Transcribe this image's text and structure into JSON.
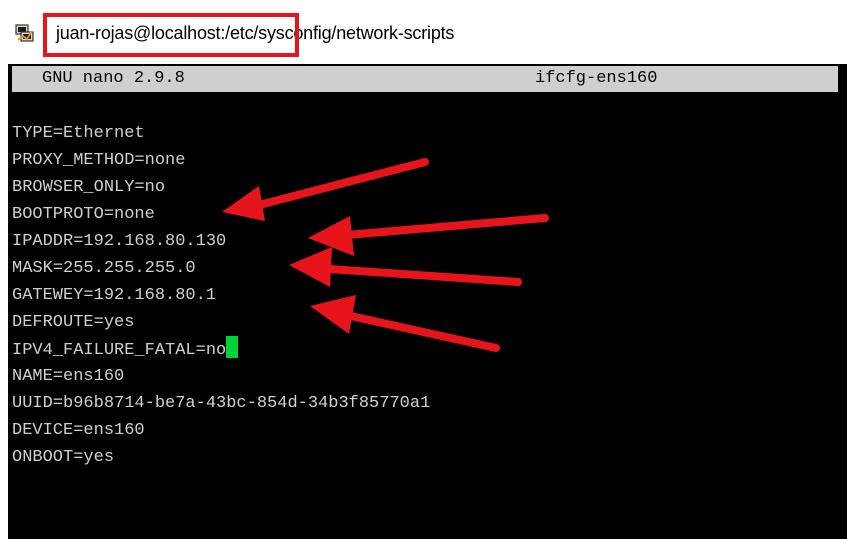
{
  "window": {
    "title": "juan-rojas@localhost:/etc/sysconfig/network-scripts",
    "icon": "putty-icon"
  },
  "editor": {
    "version": "GNU nano 2.9.8",
    "filename": "ifcfg-ens160",
    "lines": [
      "TYPE=Ethernet",
      "PROXY_METHOD=none",
      "BROWSER_ONLY=no",
      "BOOTPROTO=none",
      "IPADDR=192.168.80.130",
      "MASK=255.255.255.0",
      "GATEWEY=192.168.80.1",
      "DEFROUTE=yes",
      "IPV4_FAILURE_FATAL=no",
      "NAME=ens160",
      "UUID=b96b8714-be7a-43bc-854d-34b3f85770a1",
      "DEVICE=ens160",
      "ONBOOT=yes"
    ]
  },
  "colors": {
    "annotation": "#e8141b",
    "cursor": "#00d23c",
    "terminal_bg": "#000000",
    "terminal_fg": "#cfcfcf",
    "header_bg": "#cfcfcf"
  }
}
